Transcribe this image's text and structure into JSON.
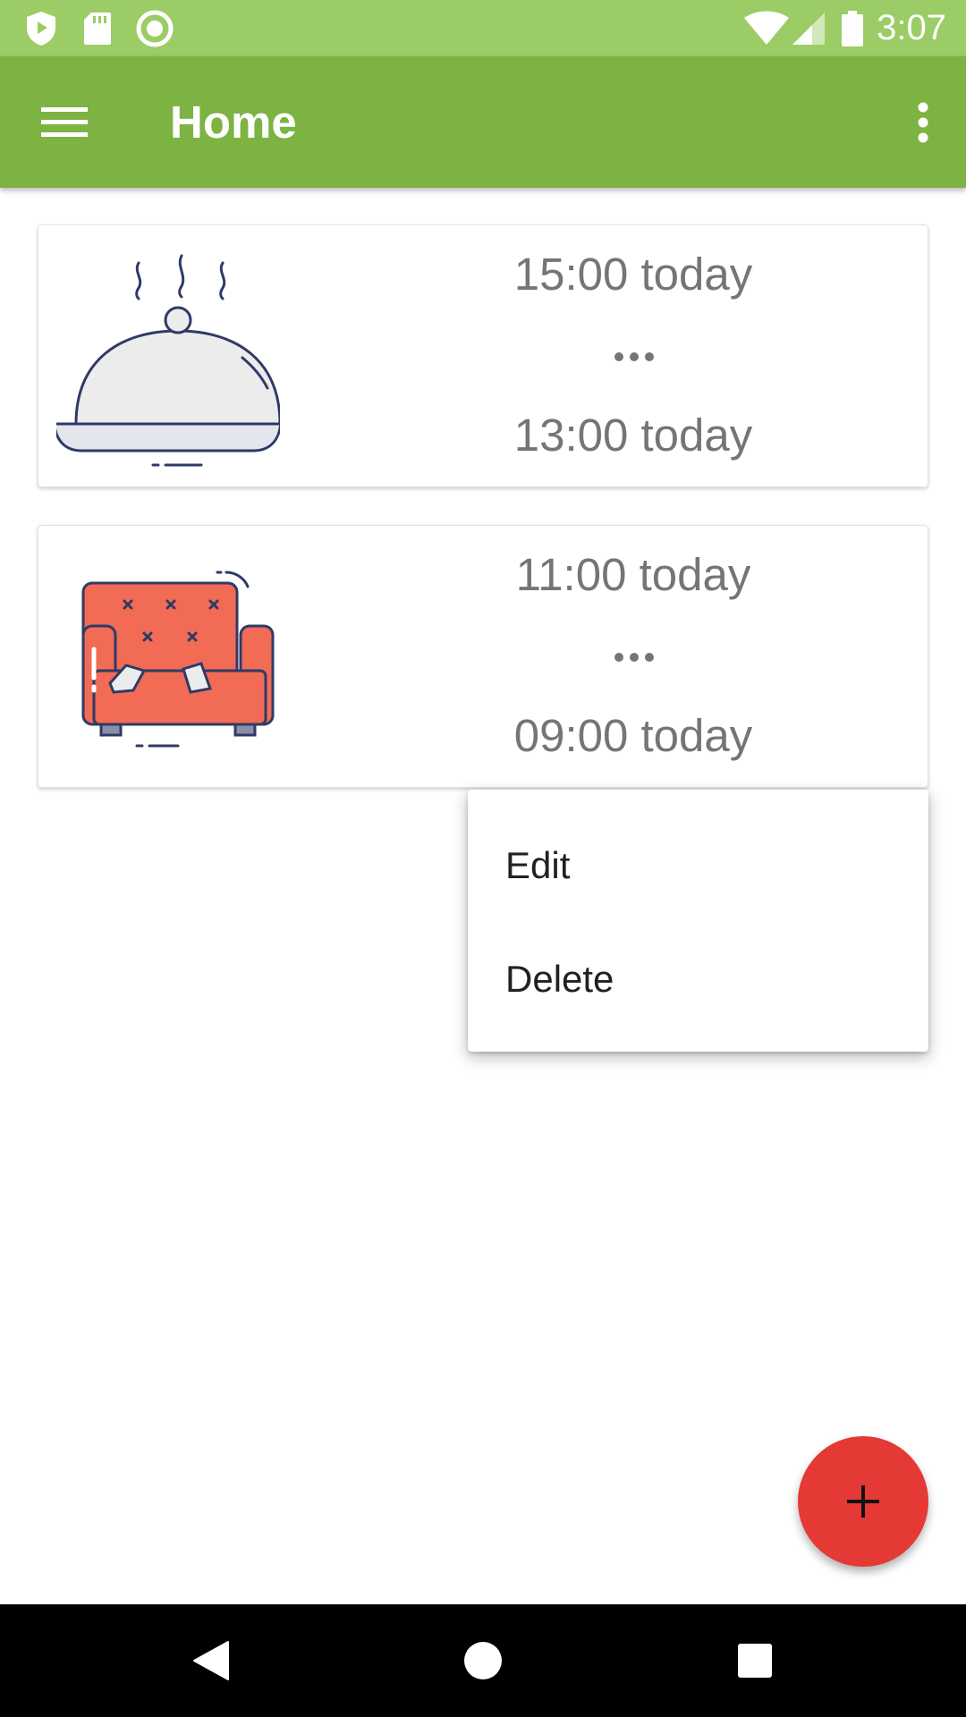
{
  "status_bar": {
    "time": "3:07",
    "left_icons": [
      "shield-play-icon",
      "sd-card-icon",
      "circle-record-icon"
    ],
    "right_icons": [
      "wifi-icon",
      "cell-signal-icon",
      "battery-icon"
    ]
  },
  "app_bar": {
    "title": "Home",
    "menu_icon": "hamburger-menu-icon",
    "more_icon": "more-vert-icon"
  },
  "cards": [
    {
      "illustration": "serving-cloche-icon",
      "time_top": "15:00 today",
      "separator": "•••",
      "time_bottom": "13:00 today"
    },
    {
      "illustration": "sofa-icon",
      "time_top": "11:00 today",
      "separator": "•••",
      "time_bottom": "09:00 today"
    }
  ],
  "context_menu": {
    "items": [
      "Edit",
      "Delete"
    ]
  },
  "fab": {
    "icon": "plus-icon"
  },
  "nav_bar": {
    "icons": [
      "back-icon",
      "home-icon",
      "recents-icon"
    ]
  },
  "colors": {
    "status_bar": "#9ccc65",
    "app_bar": "#7cb342",
    "fab": "#e53935",
    "sofa": "#f26b55",
    "outline": "#2f3a67"
  }
}
